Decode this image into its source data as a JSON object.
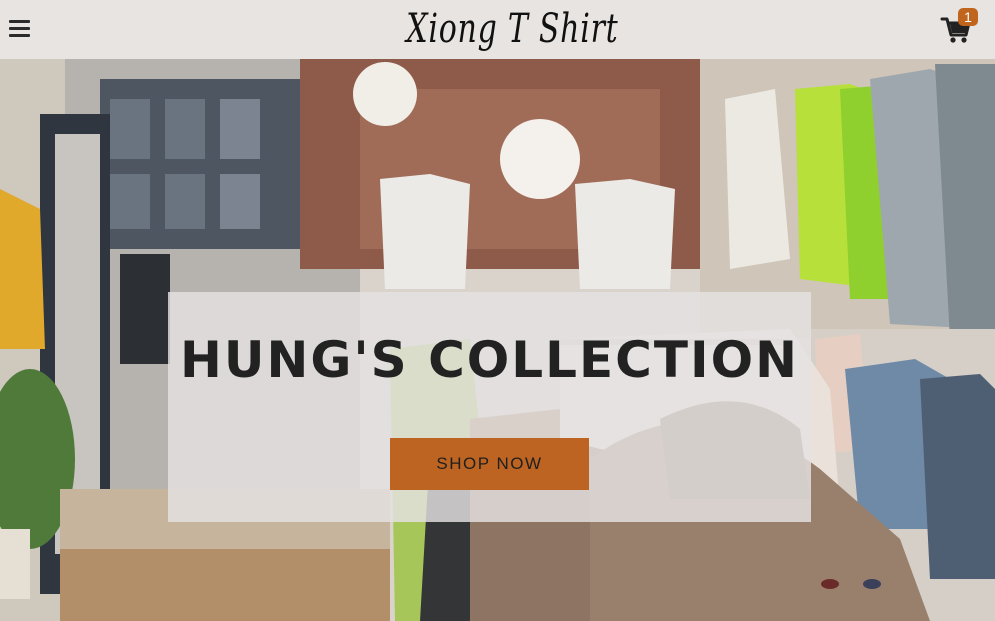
{
  "header": {
    "menu_icon": "hamburger-menu-icon",
    "brand_title": "Xiong T Shirt",
    "cart_icon": "shopping-cart-icon",
    "cart_count": "1"
  },
  "hero": {
    "background": "clothing-store-interior-photo",
    "title": "HUNG'S COLLECTION",
    "cta_label": "SHOP NOW"
  },
  "colors": {
    "accent": "#bd6422",
    "topbar_bg": "#e8e4e1",
    "text_dark": "#222222"
  }
}
